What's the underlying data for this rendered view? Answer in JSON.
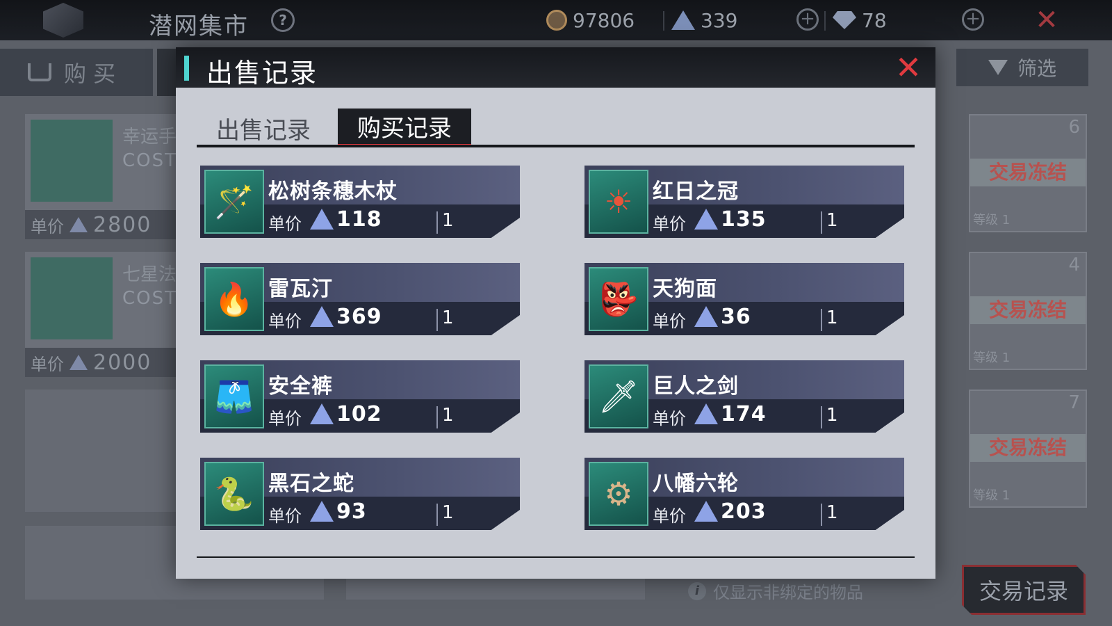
{
  "topbar": {
    "title": "潜网集市",
    "help_icon": "?",
    "coins": "97806",
    "crystals": "339",
    "gems": "78",
    "plus_icon": "+",
    "close_icon": "✕"
  },
  "background": {
    "buy_tab": "购 买",
    "filter": "筛选",
    "cards": [
      {
        "name": "幸运手",
        "cost": "COST",
        "price_label": "单价",
        "price": "2800"
      },
      {
        "name": "七星法",
        "cost": "COST",
        "price_label": "单价",
        "price": "2000"
      }
    ],
    "frozen_label": "交易冻结",
    "level_label": "等级 1",
    "frozen_corners": [
      "6",
      "4",
      "7"
    ],
    "only_unbound": "仅显示非绑定的物品",
    "info_icon": "i",
    "trade_record": "交易记录"
  },
  "modal": {
    "title": "出售记录",
    "close_icon": "✕",
    "tabs": {
      "sell": "出售记录",
      "buy": "购买记录"
    },
    "price_label": "单价",
    "records": [
      {
        "name": "松树条穗木杖",
        "price": "118",
        "qty": "1",
        "icon": "staff-icon",
        "glyph": "🪄"
      },
      {
        "name": "红日之冠",
        "price": "135",
        "qty": "1",
        "icon": "crown-icon",
        "glyph": "☀"
      },
      {
        "name": "雷瓦汀",
        "price": "369",
        "qty": "1",
        "icon": "flame-sword-icon",
        "glyph": "🔥"
      },
      {
        "name": "天狗面",
        "price": "36",
        "qty": "1",
        "icon": "tengu-mask-icon",
        "glyph": "👺"
      },
      {
        "name": "安全裤",
        "price": "102",
        "qty": "1",
        "icon": "shorts-icon",
        "glyph": "🩳"
      },
      {
        "name": "巨人之剑",
        "price": "174",
        "qty": "1",
        "icon": "giant-sword-icon",
        "glyph": "🗡"
      },
      {
        "name": "黑石之蛇",
        "price": "93",
        "qty": "1",
        "icon": "snake-icon",
        "glyph": "🐍"
      },
      {
        "name": "八幡六轮",
        "price": "203",
        "qty": "1",
        "icon": "six-ring-staff-icon",
        "glyph": "⚙"
      }
    ]
  },
  "colors": {
    "accent_red": "#e23a41",
    "header_accent": "#4fd4d0",
    "modal_bg": "#c9ccd4",
    "record_bg": "#2f3446"
  }
}
